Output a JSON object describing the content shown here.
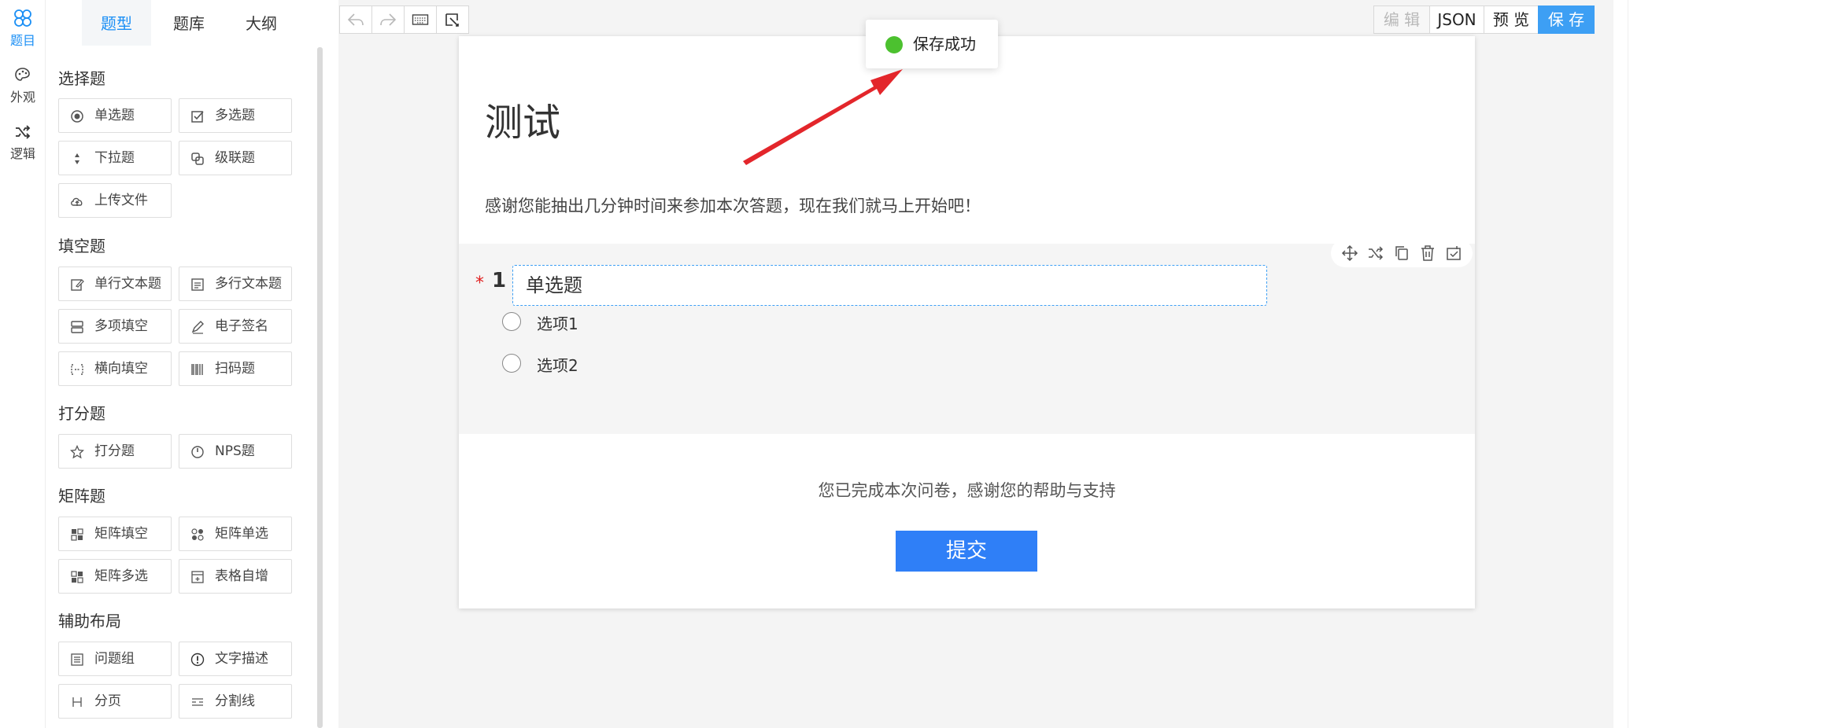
{
  "rail": {
    "items": [
      {
        "label": "题目",
        "icon": "circles-icon",
        "active": true
      },
      {
        "label": "外观",
        "icon": "palette-icon",
        "active": false
      },
      {
        "label": "逻辑",
        "icon": "shuffle-icon",
        "active": false
      }
    ]
  },
  "panel": {
    "tabs": [
      "题型",
      "题库",
      "大纲"
    ],
    "sections": {
      "choice": {
        "title": "选择题",
        "items": [
          "单选题",
          "多选题",
          "下拉题",
          "级联题",
          "上传文件"
        ]
      },
      "fill": {
        "title": "填空题",
        "items": [
          "单行文本题",
          "多行文本题",
          "多项填空",
          "电子签名",
          "横向填空",
          "扫码题"
        ]
      },
      "score": {
        "title": "打分题",
        "items": [
          "打分题",
          "NPS题"
        ]
      },
      "matrix": {
        "title": "矩阵题",
        "items": [
          "矩阵填空",
          "矩阵单选",
          "矩阵多选",
          "表格自增"
        ]
      },
      "layout": {
        "title": "辅助布局",
        "items": [
          "问题组",
          "文字描述",
          "分页",
          "分割线"
        ]
      }
    }
  },
  "toolbar": {
    "left_icons": [
      "undo-icon",
      "redo-icon",
      "keyboard-icon",
      "ai-generate-icon"
    ],
    "edit": "编 辑",
    "json": "JSON",
    "preview": "预 览",
    "save": "保 存"
  },
  "survey": {
    "title": "测试",
    "description": "感谢您能抽出几分钟时间来参加本次答题，现在我们就马上开始吧！",
    "question": {
      "required_mark": "*",
      "number": "1",
      "title": "单选题",
      "options": [
        "选项1",
        "选项2"
      ]
    },
    "finish_text": "您已完成本次问卷，感谢您的帮助与支持",
    "submit": "提交"
  },
  "toast": {
    "message": "保存成功"
  },
  "colors": {
    "accent": "#1b8ff5",
    "primary_button": "#3d9ff4",
    "submit": "#2f7ff7",
    "success": "#4cc12f",
    "arrow": "#e3262b"
  }
}
